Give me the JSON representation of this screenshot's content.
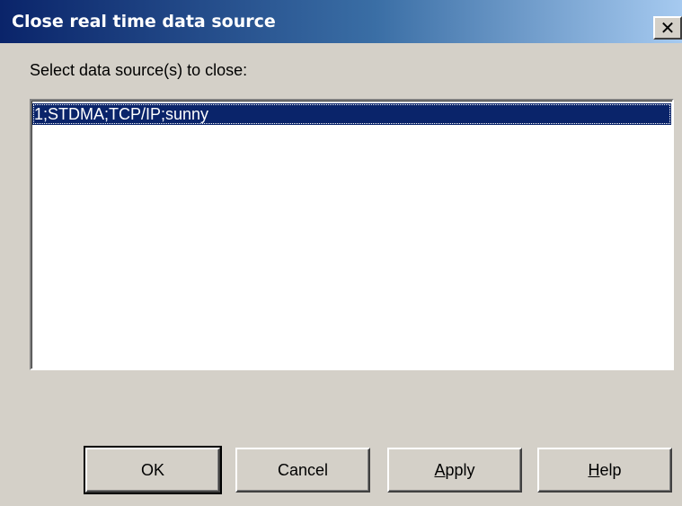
{
  "window": {
    "title": "Close real time data source",
    "close_glyph": "✕"
  },
  "prompt": "Select data source(s) to close:",
  "list": {
    "items": [
      "1;STDMA;TCP/IP;sunny"
    ],
    "selected_index": 0
  },
  "buttons": {
    "ok": "OK",
    "cancel": "Cancel",
    "apply_mnemonic": "A",
    "apply_rest": "pply",
    "help_mnemonic": "H",
    "help_rest": "elp"
  },
  "colors": {
    "titlebar_start": "#0a246a",
    "titlebar_end": "#a6caf0",
    "face": "#d4d0c8",
    "selection": "#0a246a"
  }
}
